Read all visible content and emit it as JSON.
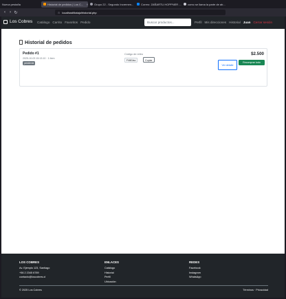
{
  "browser": {
    "tabs": [
      {
        "label": "Nueva pestaña",
        "color": "#8f8f9d",
        "active": false
      },
      {
        "label": "Historial de pedidos | Los C...",
        "color": "#ff9500",
        "active": true
      },
      {
        "label": "Grupo 22 - Segundo Incremen...",
        "color": "#9c9ca8",
        "active": false
      },
      {
        "label": "Correo: ZAÑARTU HOPPNER ...",
        "color": "#0a84ff",
        "active": false
      },
      {
        "label": "como se llama la parte de ab...",
        "color": "#cfcfd8",
        "active": false
      }
    ],
    "url": "localhost/tiatajo/historial.php"
  },
  "nav": {
    "brand": "Los Cobres",
    "links": [
      "Catálogo",
      "Carrito",
      "Favoritos",
      "Pedido"
    ],
    "search_placeholder": "Buscar productos...",
    "right_links": [
      "Perfil",
      "Mis direcciones",
      "Historial"
    ],
    "user": "Juan",
    "logout": "Cerrar sesión"
  },
  "main": {
    "title": "Historial de pedidos",
    "orders": [
      {
        "title": "Pedido #1",
        "meta": "2025-10-03 15:13:10 · 1 ítem",
        "status": "pendiente",
        "code_label": "Código de retiro",
        "code": "F4i81isc",
        "copy_label": "Copiar",
        "total": "$2.500",
        "detail_label": "Ver detalle",
        "reorder_label": "Recomprar todo"
      }
    ]
  },
  "footer": {
    "col1_title": "LOS COBRES",
    "col1_lines": [
      "Av. Ejemplo 123, Santiago",
      "+56 2 2345 6789",
      "contacto@loscobres.cl"
    ],
    "col2_title": "ENLACES",
    "col2_lines": [
      "Catálogo",
      "Historial",
      "Perfil",
      "Ubicación"
    ],
    "col3_title": "REDES",
    "col3_lines": [
      "Facebook",
      "Instagram",
      "WhatsApp"
    ],
    "copyright": "© 2025 Los Cobres",
    "legal": "Términos · Privacidad"
  }
}
